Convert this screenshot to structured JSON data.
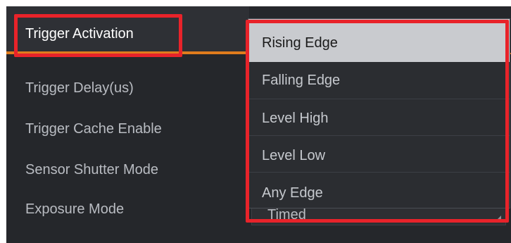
{
  "properties": [
    {
      "label": "Trigger Activation"
    },
    {
      "label": "Trigger Delay(us)"
    },
    {
      "label": "Trigger Cache Enable"
    },
    {
      "label": "Sensor Shutter Mode"
    },
    {
      "label": "Exposure Mode"
    }
  ],
  "exposure_mode_value": "Timed",
  "dropdown": {
    "selected": "Rising Edge",
    "options": [
      {
        "label": "Rising Edge"
      },
      {
        "label": "Falling Edge"
      },
      {
        "label": "Level High"
      },
      {
        "label": "Level Low"
      },
      {
        "label": "Any Edge"
      }
    ]
  },
  "colors": {
    "panel_bg": "#25272b",
    "accent": "#e07c1d",
    "highlight": "#e8232a",
    "text": "#b9bcc2",
    "selected_bg": "#c9cbcf"
  }
}
